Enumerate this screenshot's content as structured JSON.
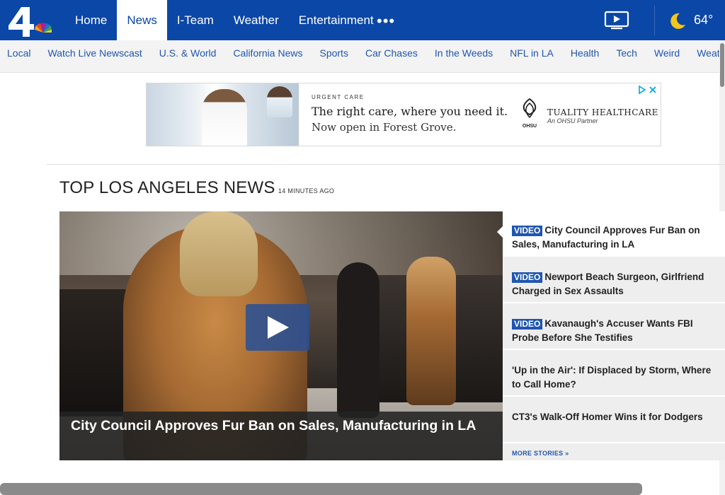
{
  "header": {
    "nav": [
      {
        "label": "Home",
        "active": false
      },
      {
        "label": "News",
        "active": true
      },
      {
        "label": "I-Team",
        "active": false
      },
      {
        "label": "Weather",
        "active": false
      },
      {
        "label": "Entertainment",
        "active": false
      }
    ],
    "more_label": "•••",
    "temperature": "64°",
    "brand_colors": {
      "nav_bg": "#0b47a6",
      "link": "#1f56b0"
    }
  },
  "subnav": [
    "Local",
    "Watch Live Newscast",
    "U.S. & World",
    "California News",
    "Sports",
    "Car Chases",
    "In the Weeds",
    "NFL in LA",
    "Health",
    "Tech",
    "Weird",
    "Weather"
  ],
  "ad": {
    "eyebrow": "URGENT CARE",
    "headline": "The right care, where you need it.",
    "subline": "Now open in Forest Grove.",
    "brand": "TUALITY HEALTHCARE",
    "brand_sub": "An OHSU Partner",
    "brand_mark": "OHSU"
  },
  "section": {
    "title": "TOP LOS ANGELES NEWS",
    "time": "14 MINUTES AGO"
  },
  "hero": {
    "caption": "City Council Approves Fur Ban on Sales, Manufacturing in LA"
  },
  "stories": [
    {
      "badge": "VIDEO",
      "title": "City Council Approves Fur Ban on Sales, Manufacturing in LA"
    },
    {
      "badge": "VIDEO",
      "title": "Newport Beach Surgeon, Girlfriend Charged in Sex Assaults"
    },
    {
      "badge": "VIDEO",
      "title": "Kavanaugh's Accuser Wants FBI Probe Before She Testifies"
    },
    {
      "badge": "",
      "title": "'Up in the Air': If Displaced by Storm, Where to Call Home?"
    },
    {
      "badge": "",
      "title": "CT3's Walk-Off Homer Wins it for Dodgers"
    }
  ],
  "more_stories": "MORE STORIES »"
}
